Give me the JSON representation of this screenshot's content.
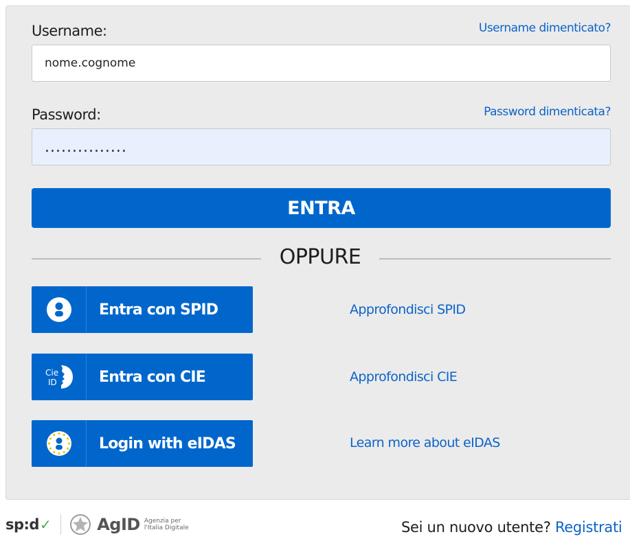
{
  "login": {
    "username_label": "Username:",
    "username_forgot": "Username dimenticato?",
    "username_value": "nome.cognome",
    "password_label": "Password:",
    "password_forgot": "Password dimenticata?",
    "password_value": "...............",
    "submit_label": "ENTRA"
  },
  "separator": {
    "label": "OPPURE"
  },
  "identity": [
    {
      "label": "Entra con SPID",
      "more": "Approfondisci SPID",
      "icon": "spid-user-icon"
    },
    {
      "label": "Entra con CIE",
      "more": "Approfondisci CIE",
      "icon": "cie-id-icon",
      "icon_text": [
        "Cie",
        "ID"
      ]
    },
    {
      "label": "Login with eIDAS",
      "more": "Learn more about eIDAS",
      "icon": "eidas-eu-icon"
    }
  ],
  "footer": {
    "spid_logo": "sp:d",
    "agid_logo": "AgID",
    "agid_sub": [
      "Agenzia per",
      "l'Italia Digitale"
    ],
    "register_prompt": "Sei un nuovo utente?",
    "register_link": "Registrati"
  },
  "colors": {
    "primary": "#0066cc",
    "link": "#0b63c9",
    "panel": "#ebebeb",
    "autofill": "#e8f0fe"
  }
}
